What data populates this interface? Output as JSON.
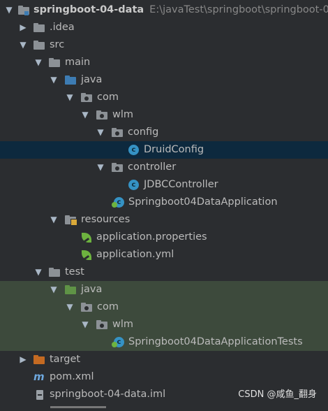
{
  "project": {
    "name": "springboot-04-data",
    "path": "E:\\javaTest\\springboot\\springboot-0"
  },
  "tree": [
    {
      "label": ".idea",
      "icon": "grey-folder-icon"
    },
    {
      "label": "src",
      "icon": "grey-folder-icon"
    },
    {
      "label": "main",
      "icon": "grey-folder-icon"
    },
    {
      "label": "java",
      "icon": "blue-source-folder-icon"
    },
    {
      "label": "com",
      "icon": "package-icon"
    },
    {
      "label": "wlm",
      "icon": "package-icon"
    },
    {
      "label": "config",
      "icon": "package-icon"
    },
    {
      "label": "DruidConfig",
      "icon": "class-icon",
      "selected": true
    },
    {
      "label": "controller",
      "icon": "package-icon"
    },
    {
      "label": "JDBCController",
      "icon": "class-icon"
    },
    {
      "label": "Springboot04DataApplication",
      "icon": "spring-boot-class-icon"
    },
    {
      "label": "resources",
      "icon": "resources-folder-icon"
    },
    {
      "label": "application.properties",
      "icon": "spring-leaf-icon"
    },
    {
      "label": "application.yml",
      "icon": "spring-leaf-icon"
    },
    {
      "label": "test",
      "icon": "grey-folder-icon"
    },
    {
      "label": "java",
      "icon": "green-test-folder-icon"
    },
    {
      "label": "com",
      "icon": "package-icon"
    },
    {
      "label": "wlm",
      "icon": "package-icon"
    },
    {
      "label": "Springboot04DataApplicationTests",
      "icon": "spring-boot-class-icon"
    },
    {
      "label": "target",
      "icon": "orange-excluded-folder-icon"
    },
    {
      "label": "pom.xml",
      "icon": "maven-icon"
    },
    {
      "label": "springboot-04-data.iml",
      "icon": "iml-file-icon"
    }
  ],
  "watermark": "CSDN @咸鱼_翻身",
  "colors": {
    "background": "#2b2d30",
    "selection": "#0d293e",
    "test_highlight": "#3d4a3c",
    "class_icon": "#3592c4",
    "spring_green": "#6db33f",
    "excluded_orange": "#c46a22"
  }
}
